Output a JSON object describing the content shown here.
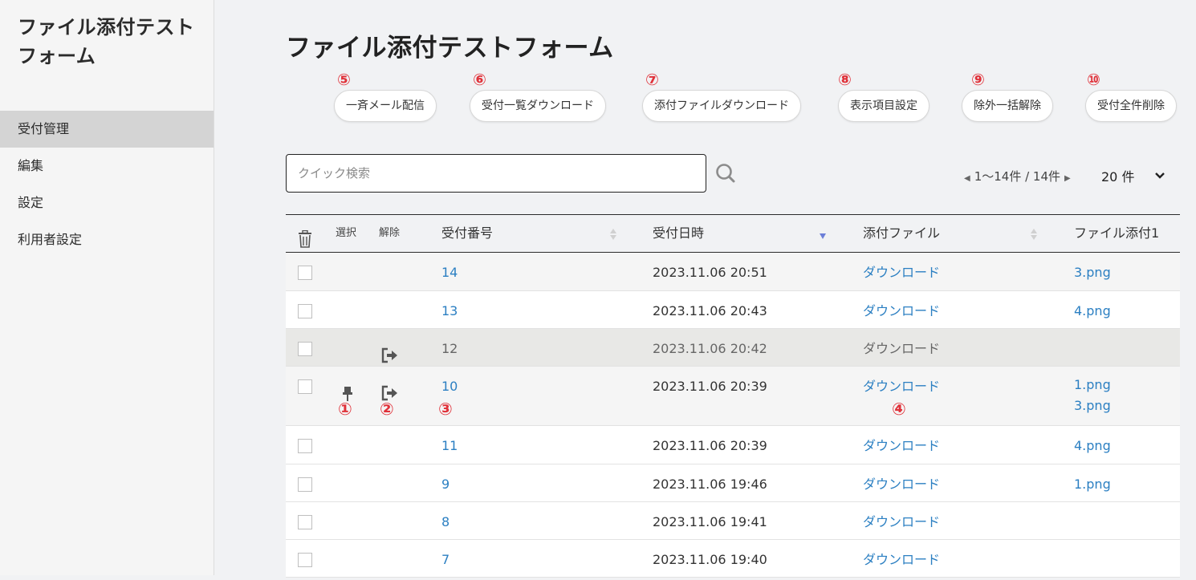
{
  "sidebar": {
    "title": "ファイル添付テストフォーム",
    "items": [
      {
        "label": "受付管理",
        "active": true
      },
      {
        "label": "編集",
        "active": false
      },
      {
        "label": "設定",
        "active": false
      },
      {
        "label": "利用者設定",
        "active": false
      }
    ]
  },
  "page": {
    "title": "ファイル添付テストフォーム"
  },
  "actions": [
    {
      "num": "⑤",
      "label": "一斉メール配信"
    },
    {
      "num": "⑥",
      "label": "受付一覧ダウンロード"
    },
    {
      "num": "⑦",
      "label": "添付ファイルダウンロード"
    },
    {
      "num": "⑧",
      "label": "表示項目設定"
    },
    {
      "num": "⑨",
      "label": "除外一括解除"
    },
    {
      "num": "⑩",
      "label": "受付全件削除"
    }
  ],
  "search": {
    "placeholder": "クイック検索",
    "value": ""
  },
  "pager": {
    "range": "1〜14件 / 14件",
    "per_page": "20 件"
  },
  "table": {
    "headers": {
      "select": "選択",
      "exclude": "解除",
      "id": "受付番号",
      "date": "受付日時",
      "attachment": "添付ファイル",
      "file1": "ファイル添付1"
    },
    "rows": [
      {
        "id": "14",
        "date": "2023.11.06 20:51",
        "download": "ダウンロード",
        "file1": "3.png"
      },
      {
        "id": "13",
        "date": "2023.11.06 20:43",
        "download": "ダウンロード",
        "file1": "4.png"
      },
      {
        "id": "12",
        "date": "2023.11.06 20:42",
        "download": "ダウンロード",
        "file1": "",
        "excluded": true
      },
      {
        "id": "10",
        "date": "2023.11.06 20:39",
        "download": "ダウンロード",
        "file1": "1.png",
        "file1b": "3.png",
        "pinned": true
      },
      {
        "id": "11",
        "date": "2023.11.06 20:39",
        "download": "ダウンロード",
        "file1": "4.png"
      },
      {
        "id": "9",
        "date": "2023.11.06 19:46",
        "download": "ダウンロード",
        "file1": "1.png"
      },
      {
        "id": "8",
        "date": "2023.11.06 19:41",
        "download": "ダウンロード",
        "file1": ""
      },
      {
        "id": "7",
        "date": "2023.11.06 19:40",
        "download": "ダウンロード",
        "file1": ""
      }
    ]
  },
  "annotations": {
    "pin": "①",
    "exclude": "②",
    "id": "③",
    "download": "④"
  },
  "colors": {
    "accent_red": "#e0323a",
    "link_blue": "#2b7fc2",
    "sidebar_active": "#d4d4d4"
  }
}
